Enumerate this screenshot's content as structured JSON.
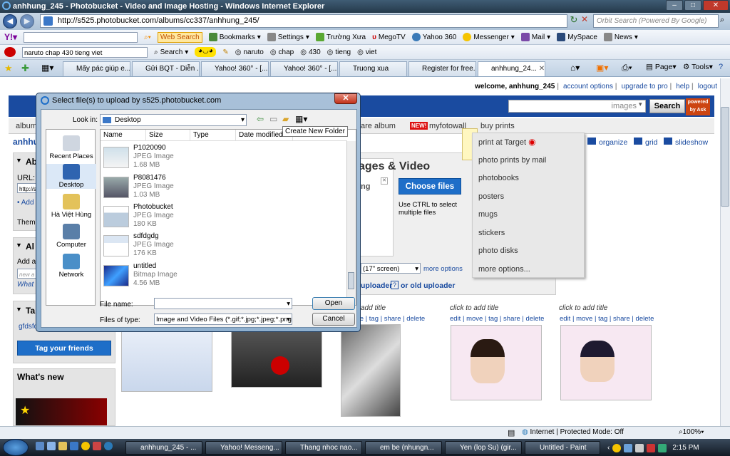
{
  "window": {
    "title": "anhhung_245 - Photobucket - Video and Image Hosting - Windows Internet Explorer"
  },
  "address": {
    "url": "http://s525.photobucket.com/albums/cc337/anhhung_245/"
  },
  "ie_search": {
    "placeholder": "Orbit Search (Powered By Google)"
  },
  "yahoo_toolbar": {
    "web_search": "Web Search",
    "items": [
      "Bookmarks",
      "Settings",
      "Trường Xưa",
      "MegoTV",
      "Yahoo 360",
      "Messenger",
      "Mail",
      "MySpace",
      "News"
    ]
  },
  "toolbar2": {
    "query": "naruto chap 430 tieng viet",
    "search": "Search",
    "terms": [
      "naruto",
      "chap",
      "430",
      "tieng",
      "viet"
    ]
  },
  "tabs": [
    {
      "label": "Mấy pác giúp e..."
    },
    {
      "label": "Gửi BQT - Diễn ..."
    },
    {
      "label": "Yahoo! 360° - [..."
    },
    {
      "label": "Yahoo! 360° - [..."
    },
    {
      "label": "Truong xua"
    },
    {
      "label": "Register for free..."
    },
    {
      "label": "anhhung_24..."
    }
  ],
  "ie_cmds": {
    "page": "Page",
    "tools": "Tools"
  },
  "pb": {
    "welcome": "welcome, anhhung_245",
    "links": [
      "account options",
      "upgrade to pro",
      "help",
      "logout"
    ],
    "search_placeholder": "images",
    "search_btn": "Search",
    "powered": "powered by Ask",
    "nav_album": "album",
    "nav_share": "are album",
    "new_badge": "NEW!",
    "myfotowall": "myfotowall",
    "buy_prints": "buy prints",
    "username": "anhhung_245",
    "organize": "organize",
    "grid": "grid",
    "slideshow": "slideshow",
    "upload_title": "ages & Video",
    "upload_sub": "ing",
    "choose_files": "Choose files",
    "ctrl_hint": "Use CTRL to select multiple files",
    "screen_size": "(17\" screen)",
    "more_options": "more options",
    "uploader": "uploader",
    "uploader_q": "?",
    "or_old": "or old uploader",
    "side": {
      "ab": "Ab",
      "url": "URL:",
      "url_val": "http://s",
      "add": "Add",
      "them": "Them",
      "al": "Al",
      "add2": "Add a",
      "new_val": "new a",
      "what": "What",
      "ta": "Ta",
      "gfdsf": "gfdsfd",
      "tag_friends": "Tag your friends",
      "whats_new": "What's new"
    },
    "thumbs": [
      {
        "title": "click to add title",
        "actions": [
          "edit",
          "move",
          "tag",
          "share",
          "delete"
        ]
      },
      {
        "title": "click to add title",
        "actions": [
          "edit",
          "move",
          "tag",
          "share",
          "delete"
        ]
      },
      {
        "title": "click to add title",
        "actions": [
          "edit",
          "move",
          "tag",
          "share",
          "delete"
        ]
      }
    ],
    "partial_actions": "ve | tag | share | delete",
    "partial_title": "add title",
    "menu": [
      "print at Target",
      "photo prints by mail",
      "photobooks",
      "posters",
      "mugs",
      "stickers",
      "photo disks",
      "more options..."
    ]
  },
  "dialog": {
    "title": "Select file(s) to upload by s525.photobucket.com",
    "look_in_label": "Look in:",
    "look_in": "Desktop",
    "tooltip": "Create New Folder",
    "places": [
      "Recent Places",
      "Desktop",
      "Hà Việt Hùng",
      "Computer",
      "Network"
    ],
    "columns": [
      "Name",
      "Size",
      "Type",
      "Date modified"
    ],
    "files": [
      {
        "name": "P1020090",
        "type": "JPEG Image",
        "size": "1.68 MB"
      },
      {
        "name": "P8081476",
        "type": "JPEG Image",
        "size": "1.03 MB"
      },
      {
        "name": "Photobucket",
        "type": "JPEG Image",
        "size": "180 KB"
      },
      {
        "name": "sdfdgdg",
        "type": "JPEG Image",
        "size": "176 KB"
      },
      {
        "name": "untitled",
        "type": "Bitmap Image",
        "size": "4.56 MB"
      }
    ],
    "file_name_label": "File name:",
    "file_name": "",
    "files_type_label": "Files of type:",
    "files_type": "Image and Video Files (*.gif;*.jpg;*.jpeg;*.png;*.l",
    "open": "Open",
    "cancel": "Cancel"
  },
  "status": {
    "zone": "Internet | Protected Mode: Off",
    "zoom": "100%"
  },
  "taskbar": {
    "items": [
      "anhhung_245 - ...",
      "Yahoo! Messeng...",
      "Thang nhoc nao...",
      "em be (nhungn...",
      "Yen (lop Su) (gir...",
      "Untitled - Paint"
    ],
    "clock": "2:15 PM"
  },
  "colors": {
    "pb_blue": "#1a4ba0",
    "choose_btn": "#1e6ec8",
    "new_badge": "#d11"
  }
}
